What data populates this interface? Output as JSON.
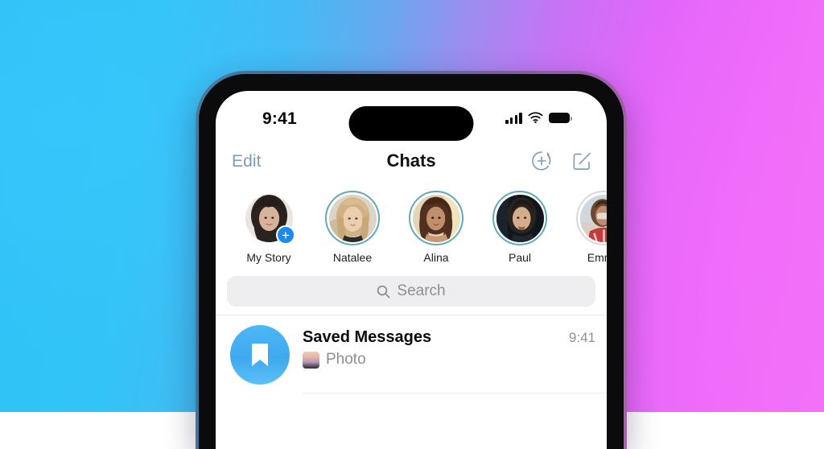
{
  "background": {
    "left_color": "#2ec2f7",
    "right_color": "#ee6bfa",
    "description": "cyan-to-magenta gradient"
  },
  "device": {
    "frame_color": "#0b0b0e",
    "rim_color": "#8a5fa3"
  },
  "status_bar": {
    "time": "9:41",
    "signal_icon": "cellular-signal-icon",
    "wifi_icon": "wifi-icon",
    "battery_icon": "battery-full-icon"
  },
  "nav_bar": {
    "edit_label": "Edit",
    "title": "Chats",
    "add_story_icon": "add-story-plus-circle-icon",
    "compose_icon": "compose-pencil-square-icon",
    "accent_color": "#7d9bb4"
  },
  "stories": {
    "ring_unread_color": "#62a9b8",
    "ring_seen_color": "#d8d8da",
    "badge_color": "#1a8cf0",
    "items": [
      {
        "name": "My Story",
        "ring": "none",
        "has_add_badge": true
      },
      {
        "name": "Natalee",
        "ring": "unread",
        "has_add_badge": false
      },
      {
        "name": "Alina",
        "ring": "unread",
        "has_add_badge": false
      },
      {
        "name": "Paul",
        "ring": "unread",
        "has_add_badge": false
      },
      {
        "name": "Emma",
        "ring": "seen",
        "has_add_badge": false
      }
    ]
  },
  "search": {
    "placeholder": "Search",
    "icon": "search-magnifier-icon"
  },
  "chats": [
    {
      "title": "Saved Messages",
      "preview": "Photo",
      "time": "9:41",
      "avatar_icon": "bookmark-icon",
      "avatar_color": "#44b2f2",
      "has_thumbnail": true
    }
  ]
}
